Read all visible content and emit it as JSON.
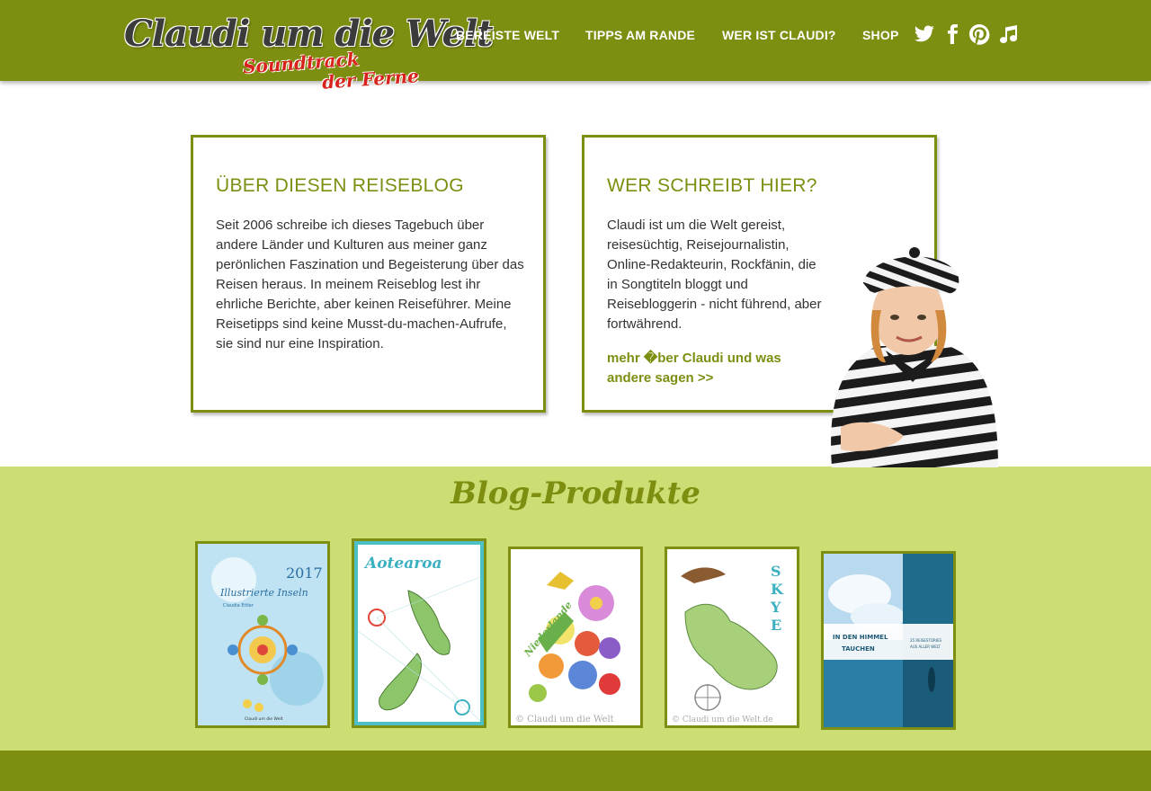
{
  "header": {
    "logo": {
      "title": "Claudi um die Welt",
      "subtitle_line1": "Soundtrack",
      "subtitle_line2": "der Ferne"
    },
    "nav": [
      {
        "label": "BEREISTE WELT"
      },
      {
        "label": "TIPPS AM RANDE"
      },
      {
        "label": "WER IST CLAUDI?"
      },
      {
        "label": "SHOP"
      }
    ],
    "social_icons": [
      "twitter-icon",
      "facebook-icon",
      "pinterest-icon",
      "music-note-icon"
    ]
  },
  "about": {
    "title": "ÜBER DIESEN REISEBLOG",
    "text": "Seit 2006 schreibe ich dieses Tagebuch über andere Länder und Kulturen aus meiner ganz perönlichen Faszination und Begeisterung über das Reisen heraus. In meinem Reiseblog lest ihr ehrliche Berichte, aber keinen Reiseführer. Meine Reisetipps sind keine Musst-du-machen-Aufrufe, sie sind nur eine Inspiration."
  },
  "author": {
    "title": "WER SCHREIBT HIER?",
    "text": "Claudi ist um die Welt gereist, reisesüchtig, Reisejournalistin, Online-Redakteurin, Rockfänin, die in Songtiteln bloggt und Reisebloggerin - nicht führend, aber fortwährend.",
    "link": "mehr �ber Claudi und was andere sagen >>"
  },
  "products": {
    "title": "Blog-Produkte",
    "items": [
      {
        "name": "illustrierte-inseln-2017",
        "cover_title": "2017",
        "cover_subtitle": "Illustrierte Inseln",
        "cover_author": "Claudia Ettler",
        "cover_footer": "Claudi um die Welt"
      },
      {
        "name": "aotearoa",
        "cover_title": "Aotearoa"
      },
      {
        "name": "niederlande",
        "cover_title": "Niederlande",
        "cover_footer": "© Claudi um die Welt"
      },
      {
        "name": "skye",
        "cover_title": "SKYE",
        "cover_footer": "© Claudi um die Welt.de"
      },
      {
        "name": "in-den-himmel-tauchen",
        "cover_title_line1": "IN DEN HIMMEL",
        "cover_title_line2": "TAUCHEN",
        "cover_subtitle_line1": "25 REISESTORIES",
        "cover_subtitle_line2": "AUS ALLER WELT"
      }
    ]
  },
  "colors": {
    "primary": "#7d8e10",
    "light_green": "#cbdd73",
    "logo_red": "#d8231d"
  }
}
